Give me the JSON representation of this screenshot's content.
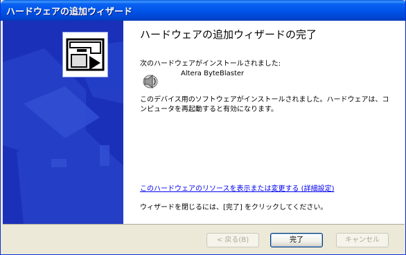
{
  "window": {
    "title": "ハードウェアの追加ウィザード"
  },
  "main": {
    "heading": "ハードウェアの追加ウィザードの完了",
    "installed_label": "次のハードウェアがインストールされました:",
    "device_name": "Altera ByteBlaster",
    "device_icon": "speaker-icon",
    "message_line1": "このデバイス用のソフトウェアがインストールされました。ハードウェアは、コ",
    "message_line2": "ンピュータを再起動すると有効になります。",
    "resource_link": "このハードウェアのリソースを表示または変更する (詳細設定)",
    "finish_instruction": "ウィザードを閉じるには、[完了] をクリックしてください。"
  },
  "footer": {
    "back_label": "< 戻る(B)",
    "finish_label": "完了",
    "cancel_label": "キャンセル"
  },
  "colors": {
    "titlebar": "#0053e7",
    "sidebar": "#1b30b8",
    "link": "#0000ee"
  }
}
